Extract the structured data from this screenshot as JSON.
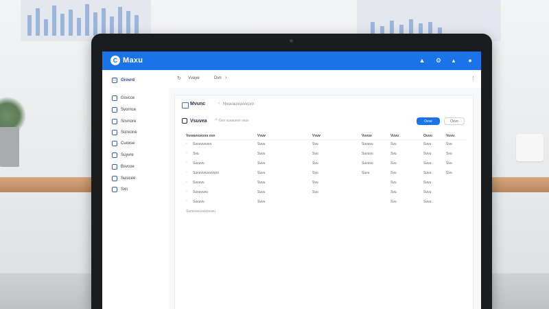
{
  "app": {
    "name": "Maxu",
    "logo": "C"
  },
  "header_icons": [
    "wifi-icon",
    "settings-icon",
    "bell-icon",
    "user-icon"
  ],
  "sidebar": {
    "items": [
      {
        "label": "Grovrd",
        "icon": "dashboard-icon",
        "active": true
      },
      {
        "label": "Gsvcce",
        "icon": "folder-icon",
        "active": false
      },
      {
        "label": "Svornce",
        "icon": "box-icon",
        "active": false
      },
      {
        "label": "Snvnore",
        "icon": "inbox-icon",
        "active": false
      },
      {
        "label": "Sunxone",
        "icon": "mail-icon",
        "active": false
      },
      {
        "label": "Cuoxse",
        "icon": "calendar-icon",
        "active": false
      },
      {
        "label": "Suyvre",
        "icon": "chart-icon",
        "active": false
      },
      {
        "label": "Bsvcoe",
        "icon": "shield-icon",
        "active": false
      },
      {
        "label": "Susicee",
        "icon": "tag-icon",
        "active": false
      },
      {
        "label": "Sxn",
        "icon": "flag-icon",
        "active": false
      }
    ]
  },
  "topbar": {
    "item1": "Vvaye",
    "item2": "Dvn",
    "item3": ""
  },
  "card": {
    "title": "Mvunc",
    "subtitle": "Nvuvauvuvvvcvn",
    "section_label": "Vsuvea",
    "search_placeholder": "Gvn vuvauevn vsuv",
    "primary_button": "Ovve",
    "secondary_button": "Ovvo"
  },
  "table": {
    "headers": [
      "Vuvauvuvuvu vuv",
      "Vvuv",
      "Vvuv",
      "Vuvuv",
      "Vuvu",
      "Ouvu",
      "Vuvu"
    ],
    "rows": [
      [
        "Suvuvuvuvu",
        "Suvu",
        "Svu",
        "Suvuvu",
        "Svu",
        "Suvu",
        "Svu"
      ],
      [
        "Svu",
        "Suvu",
        "Svu",
        "Suvuvu",
        "Svu",
        "Suvu",
        "Svu"
      ],
      [
        "Suvuvu",
        "Suvu",
        "Svu",
        "Suvuvu",
        "Svu",
        "Suvu",
        "Svu"
      ],
      [
        "Suvuvuvuvuvuvu",
        "Suvu",
        "Svu",
        "Suvu",
        "Svu",
        "Suvu",
        "Svu"
      ],
      [
        "Suvuvu",
        "Suvu",
        "Svu",
        "",
        "Svu",
        "Suvu",
        ""
      ],
      [
        "Suvuvuvu",
        "Suvu",
        "Svu",
        "",
        "Svu",
        "Suvu",
        ""
      ],
      [
        "Suvuvu",
        "Suvu",
        "",
        "",
        "Svu",
        "Suvu",
        ""
      ]
    ],
    "footer_note": "Suvuvuvuvuvuvuvu"
  },
  "colors": {
    "accent": "#1a73e8",
    "bezel": "#1b1c1e",
    "sidebar_icon": "#2f5fb3"
  }
}
